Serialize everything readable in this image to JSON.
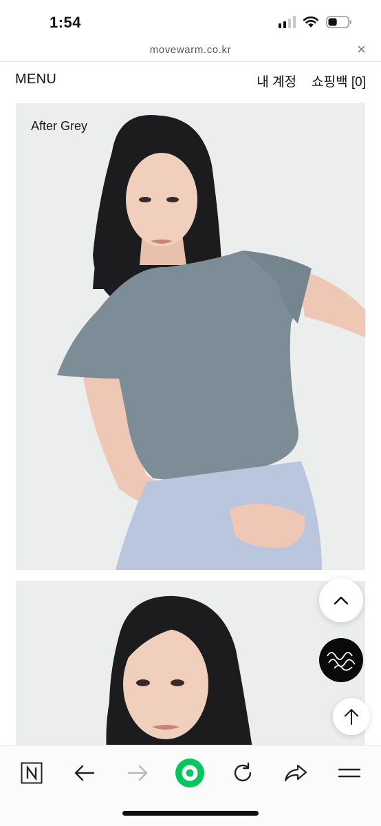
{
  "status_bar": {
    "time": "1:54",
    "battery_level": 0.45
  },
  "browser": {
    "url": "movewarm.co.kr"
  },
  "header": {
    "menu_label": "MENU",
    "account_label": "내 계정",
    "cart_label": "쇼핑백 [0]"
  },
  "product": {
    "color_name": "After Grey",
    "shirt_color": "#7d8d98",
    "pants_color": "#b9c6de",
    "background_color": "#eceded"
  },
  "floating_buttons": {
    "scroll_up_icon": "chevron-up-icon",
    "brand_logo_icon": "movewarm-logo-icon",
    "top_icon": "arrow-up-icon"
  },
  "toolbar": {
    "items": [
      "naver-n-icon",
      "back-arrow-icon",
      "forward-arrow-icon",
      "green-home-icon",
      "reload-icon",
      "share-icon",
      "menu-icon"
    ],
    "accent_color": "#03c75a"
  }
}
